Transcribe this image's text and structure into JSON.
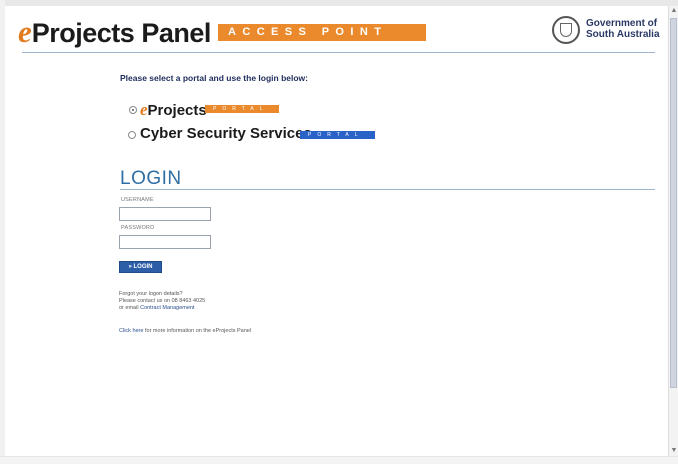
{
  "header": {
    "brand_e": "e",
    "brand_name": "Projects Panel",
    "access_point": "ACCESS POINT",
    "gov_line1": "Government of",
    "gov_line2": "South Australia"
  },
  "portal_select": {
    "heading": "Please select a portal and use the login below:",
    "portals": [
      {
        "prefix": "e",
        "name": "Projects",
        "tag": "PORTAL",
        "selected": true
      },
      {
        "prefix": "",
        "name": "Cyber Security Services",
        "tag": "PORTAL",
        "selected": false
      }
    ]
  },
  "login": {
    "title": "LOGIN",
    "username_label": "USERNAME",
    "username_value": "",
    "password_label": "PASSWORD",
    "password_value": "",
    "button_label": "» LOGIN"
  },
  "help": {
    "line1": "Forgot your logon details?",
    "line2": "Please contact us on 08 8463 4025",
    "line3_prefix": "or email ",
    "line3_link": "Contract Management"
  },
  "info": {
    "link": "Click here",
    "text": " for more information on the eProjects Panel"
  },
  "colors": {
    "orange": "#ea8a2c",
    "blue_tag": "#2a63c8",
    "login_blue": "#2f6ea3"
  }
}
